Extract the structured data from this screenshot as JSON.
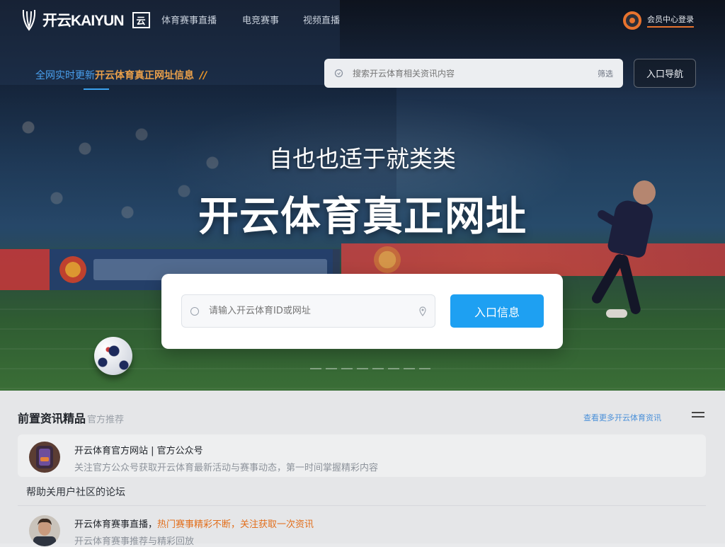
{
  "header": {
    "logo_text": "开云KAIYUN",
    "logo_badge": "云",
    "nav": [
      "体育赛事直播",
      "电竞赛事",
      "视频直播"
    ],
    "user_name": "会员中心登录"
  },
  "promo": {
    "lead": "全网实时更新",
    "main": "开云体育真正网址信息",
    "mark": "//"
  },
  "top_search": {
    "placeholder": "搜索开云体育相关资讯内容",
    "filter": "筛选",
    "button": "入口导航"
  },
  "hero": {
    "subtitle": "自也也适于就类类",
    "title": "开云体育真正网址"
  },
  "search_card": {
    "placeholder": "请输入开云体育ID或网址",
    "button": "入口信息"
  },
  "panel": {
    "title": "前置资讯精品",
    "title_sub": "官方推荐",
    "more": "查看更多开云体育资讯",
    "items": [
      {
        "title": "开云体育官方网站 | 官方公众号",
        "desc": "关注官方公众号获取开云体育最新活动与赛事动态，第一时间掌握精彩内容"
      },
      {
        "title": "开云体育赛事直播，",
        "title_highlight": "热门赛事精彩不断，",
        "title_tail": "关注获取一次资讯",
        "desc": "开云体育赛事推荐与精彩回放"
      }
    ],
    "note": "帮助关用户社区的论坛"
  },
  "colors": {
    "accent_blue": "#1ea0f2",
    "accent_orange": "#e8732e",
    "promo_gold": "#eaa04a"
  }
}
